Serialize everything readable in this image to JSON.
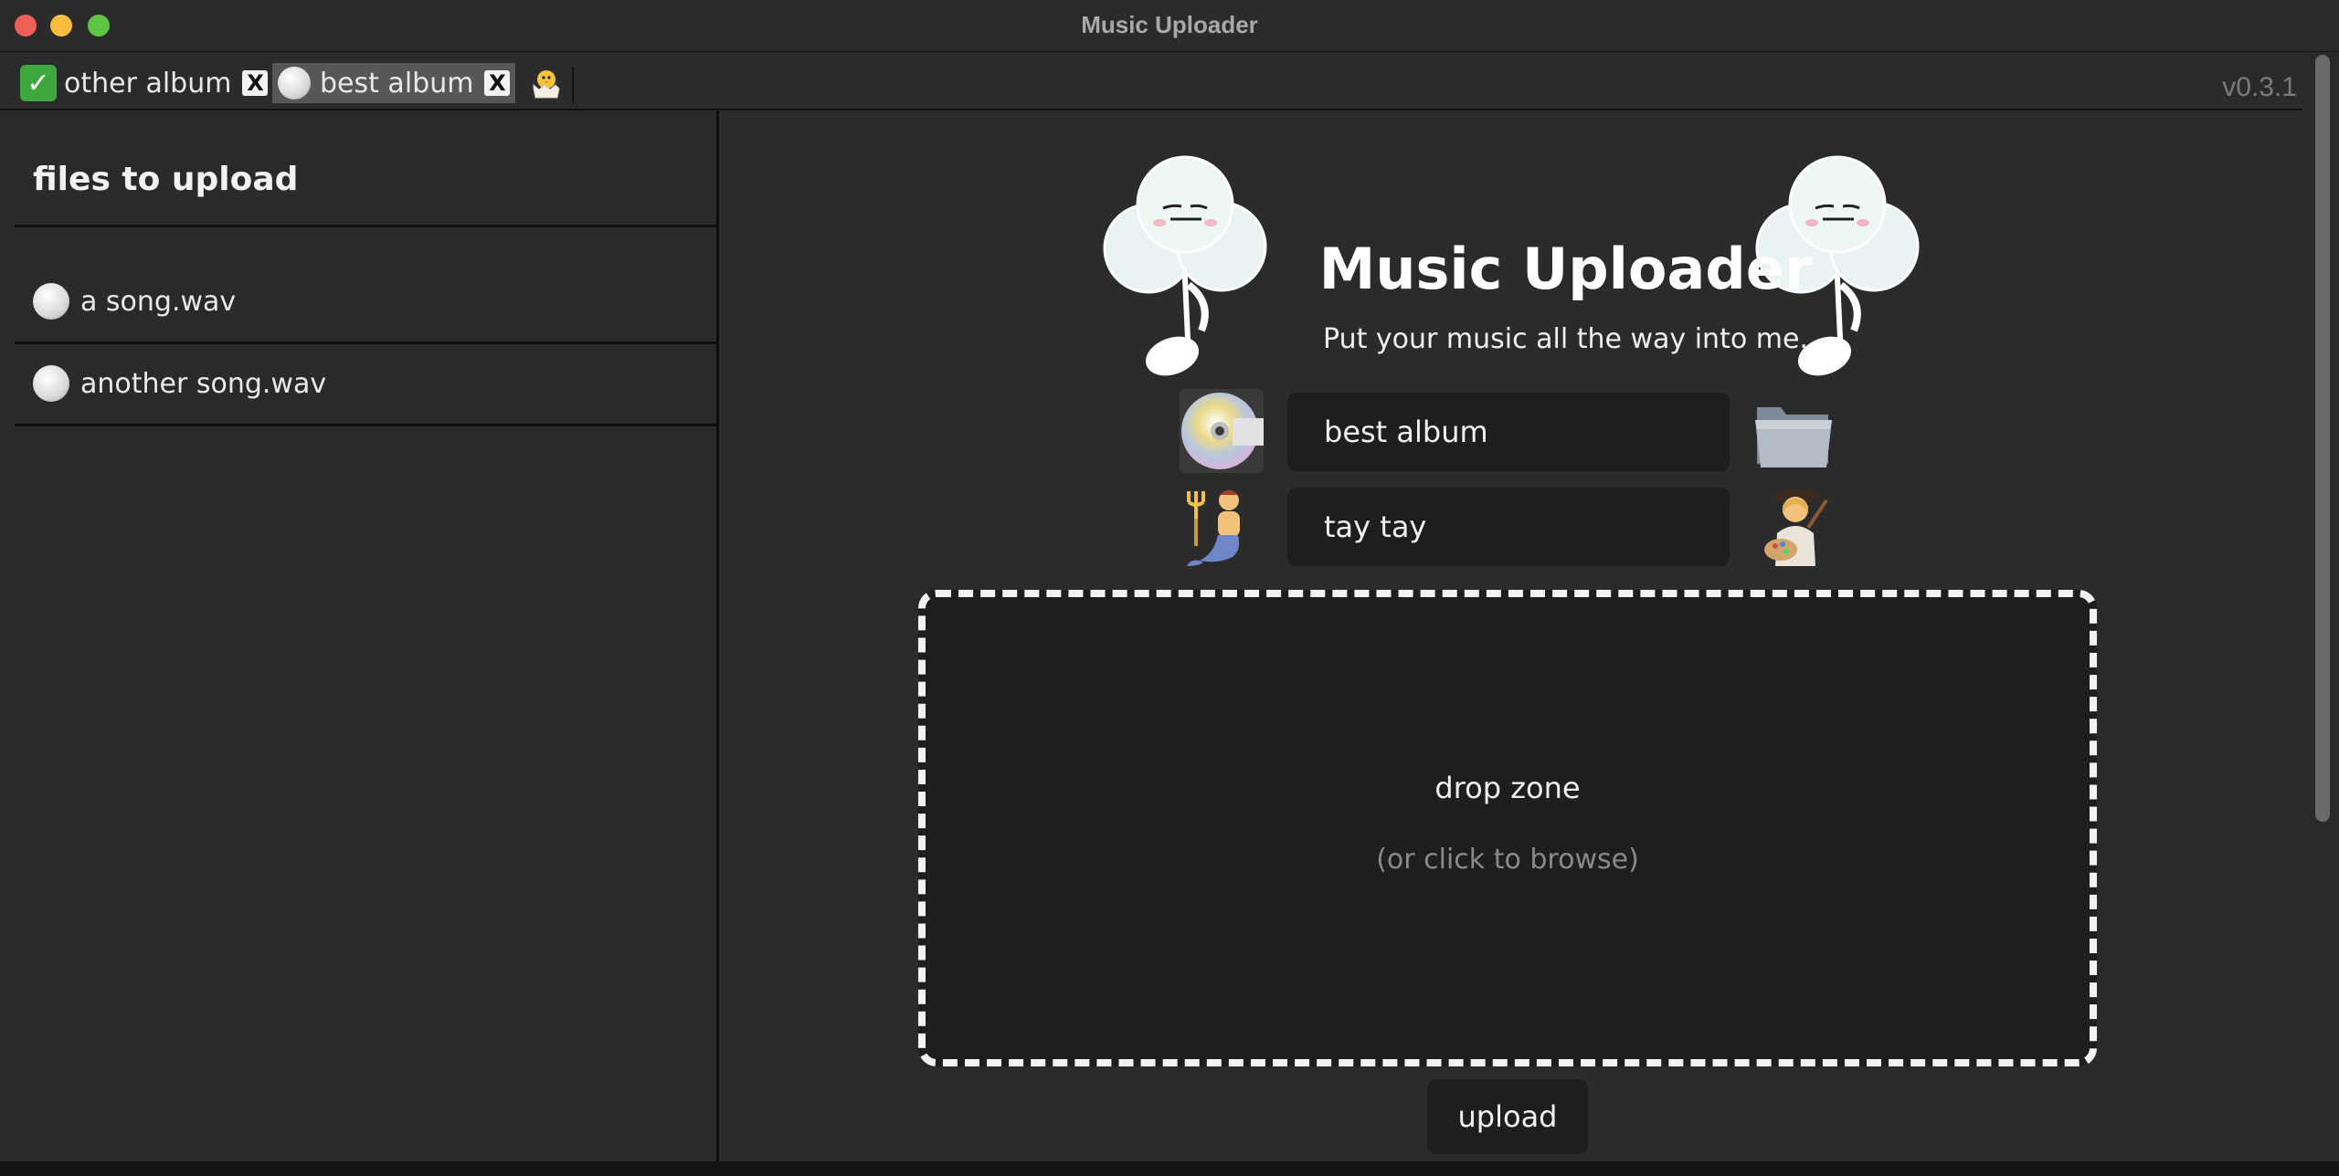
{
  "window": {
    "title": "Music Uploader"
  },
  "tabs": [
    {
      "label": "other album",
      "status": "done",
      "close_label": "X"
    },
    {
      "label": "best album",
      "status": "pending",
      "close_label": "X"
    }
  ],
  "add_tab_icon": "hatching-chick-icon",
  "version": "v0.3.1",
  "sidebar": {
    "title": "files to upload",
    "files": [
      {
        "name": "a song.wav",
        "status": "pending"
      },
      {
        "name": "another song.wav",
        "status": "pending"
      }
    ]
  },
  "main": {
    "title": "Music Uploader",
    "subtitle": "Put your music all the way into me.",
    "album_field": {
      "value": "best album",
      "icon": "cd-icon",
      "browse_icon": "folder-icon"
    },
    "artist_field": {
      "value": "tay tay",
      "icon": "merman-icon",
      "right_icon": "artist-icon"
    },
    "drop_zone": {
      "title": "drop zone",
      "subtitle": "(or click to browse)"
    },
    "upload_label": "upload"
  },
  "colors": {
    "background": "#2a2a2a",
    "field_bg": "#1e1e1e",
    "check_green": "#3ea83e"
  }
}
